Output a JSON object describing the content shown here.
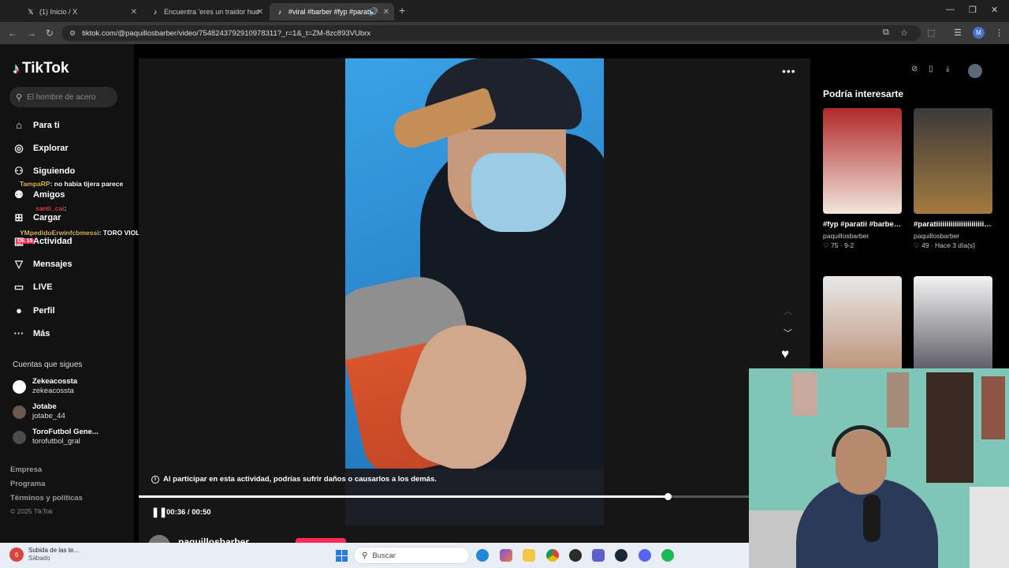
{
  "browser": {
    "tabs": [
      {
        "title": "(1) Inicio / X",
        "icon": "x-logo"
      },
      {
        "title": "Encuentra 'eres un traidor hue",
        "icon": "tiktok-logo"
      },
      {
        "title": "#viral #barber #fyp #paratii",
        "icon": "tiktok-logo"
      }
    ],
    "url": "tiktok.com/@paquillosbarber/video/7548243792910978311?_r=1&_t=ZM-8zc893VUbrx",
    "profile_initial": "M"
  },
  "sidebar": {
    "brand": "TikTok",
    "search_placeholder": "El hombre de acero",
    "nav": [
      {
        "label": "Para ti",
        "icon": "home-icon"
      },
      {
        "label": "Explorar",
        "icon": "compass-icon"
      },
      {
        "label": "Siguiendo",
        "icon": "following-icon"
      },
      {
        "label": "Amigos",
        "icon": "friends-icon"
      },
      {
        "label": "Cargar",
        "icon": "upload-icon"
      },
      {
        "label": "Actividad",
        "icon": "activity-icon"
      },
      {
        "label": "Mensajes",
        "icon": "messages-icon"
      },
      {
        "label": "LIVE",
        "icon": "live-icon"
      },
      {
        "label": "Perfil",
        "icon": "profile-icon"
      },
      {
        "label": "Más",
        "icon": "more-icon"
      }
    ],
    "activity_badge": "DE 15",
    "following_title": "Cuentas que sigues",
    "following": [
      {
        "name": "Zekeacossta",
        "handle": "zekeacossta"
      },
      {
        "name": "Jotabe",
        "handle": "jotabe_44"
      },
      {
        "name": "ToroFutbol Gene...",
        "handle": "torofutbol_gral"
      }
    ],
    "footer_links": [
      "Empresa",
      "Programa",
      "Términos y políticas"
    ],
    "copyright": "© 2025 TikTok"
  },
  "chat_overlay": [
    {
      "user": "TampaRP",
      "message": ": no habia tijera parece"
    },
    {
      "user": "santi_cai",
      "message": ":"
    },
    {
      "user": "YMpedidoErwinfcbmessi",
      "message": ": TORO VIOLIN TE FUISTE A BUENOS AIRES POR UNA"
    }
  ],
  "player": {
    "warning": "Al participar en esta actividad, podrías sufrir daños o causarlos a los demás.",
    "time": "00:36 / 00:50",
    "progress": 0.788,
    "creator": "paquillosbarber"
  },
  "recommendations": {
    "title": "Podría interesarte",
    "items": [
      {
        "caption": "#fyp #paratii #barberosdelmund...",
        "author": "paquillosbarber",
        "stats": "♡ 75 · 9-2",
        "colors": [
          "#b02a2a",
          "#f1e6dc"
        ]
      },
      {
        "caption": "#paratiiiiiiiiiiiiiiiiiiiiiiiiii #buzzcut...",
        "author": "paquillosbarber",
        "stats": "♡ 49 · Hace 3 día(s)",
        "colors": [
          "#3a3a3a",
          "#a57b3f"
        ]
      },
      {
        "caption": "",
        "author": "",
        "stats": "",
        "colors": [
          "#e8e8e8",
          "#b88a6e"
        ]
      },
      {
        "caption": "",
        "author": "",
        "stats": "",
        "colors": [
          "#f3f3f3",
          "#4b4a55"
        ]
      }
    ]
  },
  "taskbar": {
    "news_title": "Subida de las te...",
    "news_subtitle": "Sábado",
    "news_badge": "6",
    "search_placeholder": "Buscar"
  }
}
